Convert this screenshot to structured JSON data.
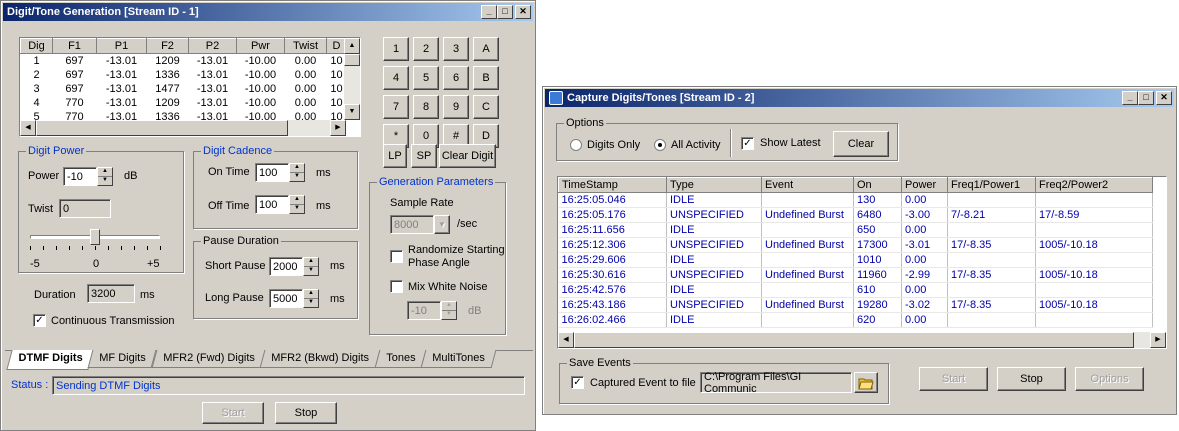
{
  "win1": {
    "title": "Digit/Tone Generation [Stream ID - 1]",
    "table": {
      "headers": [
        "Dig",
        "F1",
        "P1",
        "F2",
        "P2",
        "Pwr",
        "Twist",
        "D"
      ],
      "rows": [
        [
          "1",
          "697",
          "-13.01",
          "1209",
          "-13.01",
          "-10.00",
          "0.00",
          "10"
        ],
        [
          "2",
          "697",
          "-13.01",
          "1336",
          "-13.01",
          "-10.00",
          "0.00",
          "10"
        ],
        [
          "3",
          "697",
          "-13.01",
          "1477",
          "-13.01",
          "-10.00",
          "0.00",
          "10"
        ],
        [
          "4",
          "770",
          "-13.01",
          "1209",
          "-13.01",
          "-10.00",
          "0.00",
          "10"
        ],
        [
          "5",
          "770",
          "-13.01",
          "1336",
          "-13.01",
          "-10.00",
          "0.00",
          "10"
        ]
      ]
    },
    "keypad": [
      "1",
      "2",
      "3",
      "A",
      "4",
      "5",
      "6",
      "B",
      "7",
      "8",
      "9",
      "C",
      "*",
      "0",
      "#",
      "D"
    ],
    "lp": "LP",
    "sp": "SP",
    "clear_digit": "Clear Digit",
    "digit_power": {
      "legend": "Digit Power",
      "power_label": "Power",
      "power_value": "-10",
      "power_unit": "dB",
      "twist_label": "Twist",
      "twist_value": "0",
      "scale_min": "-5",
      "scale_mid": "0",
      "scale_max": "+5",
      "slider_value": 0
    },
    "digit_cadence": {
      "legend": "Digit Cadence",
      "on_label": "On Time",
      "on_value": "100",
      "off_label": "Off Time",
      "off_value": "100",
      "unit": "ms"
    },
    "pause_duration": {
      "legend": "Pause Duration",
      "short_label": "Short Pause",
      "short_value": "2000",
      "long_label": "Long Pause",
      "long_value": "5000",
      "unit": "ms"
    },
    "gen_params": {
      "legend": "Generation Parameters",
      "sample_rate_label": "Sample Rate",
      "sample_rate_value": "8000",
      "sample_rate_unit": "/sec",
      "randomize_line1": "Randomize Starting",
      "randomize_line2": "Phase Angle",
      "mix_noise": "Mix White Noise",
      "noise_value": "-10",
      "noise_unit": "dB"
    },
    "duration_label": "Duration",
    "duration_value": "3200",
    "duration_unit": "ms",
    "continuous": "Continuous Transmission",
    "tabs": [
      "DTMF Digits",
      "MF Digits",
      "MFR2 (Fwd) Digits",
      "MFR2 (Bkwd) Digits",
      "Tones",
      "MultiTones"
    ],
    "status_label": "Status :",
    "status_value": "Sending DTMF Digits",
    "start": "Start",
    "stop": "Stop"
  },
  "win2": {
    "title": "Capture Digits/Tones [Stream ID - 2]",
    "options": {
      "legend": "Options",
      "digits_only": "Digits Only",
      "all_activity": "All Activity",
      "show_latest": "Show Latest",
      "clear": "Clear"
    },
    "table": {
      "headers": [
        "TimeStamp",
        "Type",
        "Event",
        "On",
        "Power",
        "Freq1/Power1",
        "Freq2/Power2"
      ],
      "rows": [
        [
          "16:25:05.046",
          "IDLE",
          "",
          "130",
          "0.00",
          "",
          ""
        ],
        [
          "16:25:05.176",
          "UNSPECIFIED",
          "Undefined Burst",
          "6480",
          "-3.00",
          "7/-8.21",
          "17/-8.59"
        ],
        [
          "16:25:11.656",
          "IDLE",
          "",
          "650",
          "0.00",
          "",
          ""
        ],
        [
          "16:25:12.306",
          "UNSPECIFIED",
          "Undefined Burst",
          "17300",
          "-3.01",
          "17/-8.35",
          "1005/-10.18"
        ],
        [
          "16:25:29.606",
          "IDLE",
          "",
          "1010",
          "0.00",
          "",
          ""
        ],
        [
          "16:25:30.616",
          "UNSPECIFIED",
          "Undefined Burst",
          "11960",
          "-2.99",
          "17/-8.35",
          "1005/-10.18"
        ],
        [
          "16:25:42.576",
          "IDLE",
          "",
          "610",
          "0.00",
          "",
          ""
        ],
        [
          "16:25:43.186",
          "UNSPECIFIED",
          "Undefined Burst",
          "19280",
          "-3.02",
          "17/-8.35",
          "1005/-10.18"
        ],
        [
          "16:26:02.466",
          "IDLE",
          "",
          "620",
          "0.00",
          "",
          ""
        ]
      ]
    },
    "save_events": {
      "legend": "Save Events",
      "captured_label": "Captured Event to file",
      "path": "C:\\Program Files\\GI Communic"
    },
    "start": "Start",
    "stop": "Stop",
    "options_btn": "Options"
  }
}
